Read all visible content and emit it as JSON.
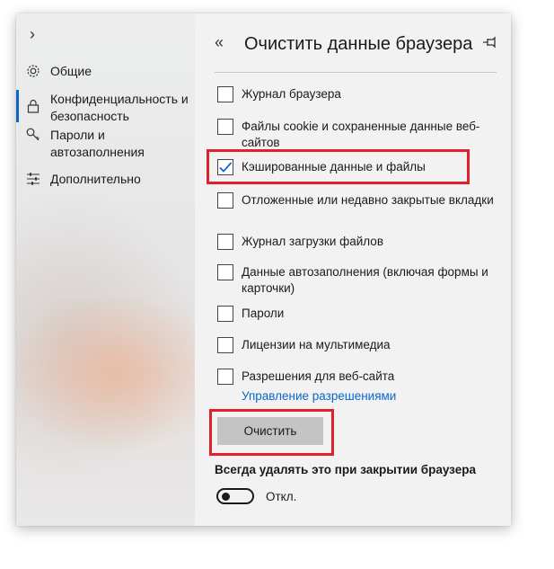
{
  "sidebar": {
    "expand_icon": "chevron-right-icon",
    "items": [
      {
        "label": "Общие",
        "icon": "gear-icon"
      },
      {
        "label": "Конфиденциальность и безопасность",
        "icon": "lock-icon"
      },
      {
        "label": "Пароли и автозаполнения",
        "icon": "key-icon"
      },
      {
        "label": "Дополнительно",
        "icon": "sliders-icon"
      }
    ],
    "active_index": 1,
    "accent": "#0a67c9"
  },
  "panel": {
    "back_icon": "double-chevron-left-icon",
    "title": "Очистить данные браузера",
    "pin_icon": "pin-icon",
    "options": [
      {
        "label": "Журнал браузера",
        "checked": false
      },
      {
        "label": "Файлы cookie и сохраненные данные веб-сайтов",
        "checked": false
      },
      {
        "label": "Кэшированные данные и файлы",
        "checked": true
      },
      {
        "label": "Отложенные или недавно закрытые вкладки",
        "checked": false
      },
      {
        "label": "Журнал загрузки файлов",
        "checked": false
      },
      {
        "label": "Данные автозаполнения (включая формы и карточки)",
        "checked": false
      },
      {
        "label": "Пароли",
        "checked": false
      },
      {
        "label": "Лицензии на мультимедиа",
        "checked": false
      },
      {
        "label": "Разрешения для веб-сайта",
        "checked": false
      }
    ],
    "manage_link": "Управление разрешениями",
    "clear_button": "Очистить",
    "always_clear_label": "Всегда удалять это при закрытии браузера",
    "toggle": {
      "state": "off",
      "label": "Откл."
    },
    "highlight_color": "#e0202c"
  }
}
